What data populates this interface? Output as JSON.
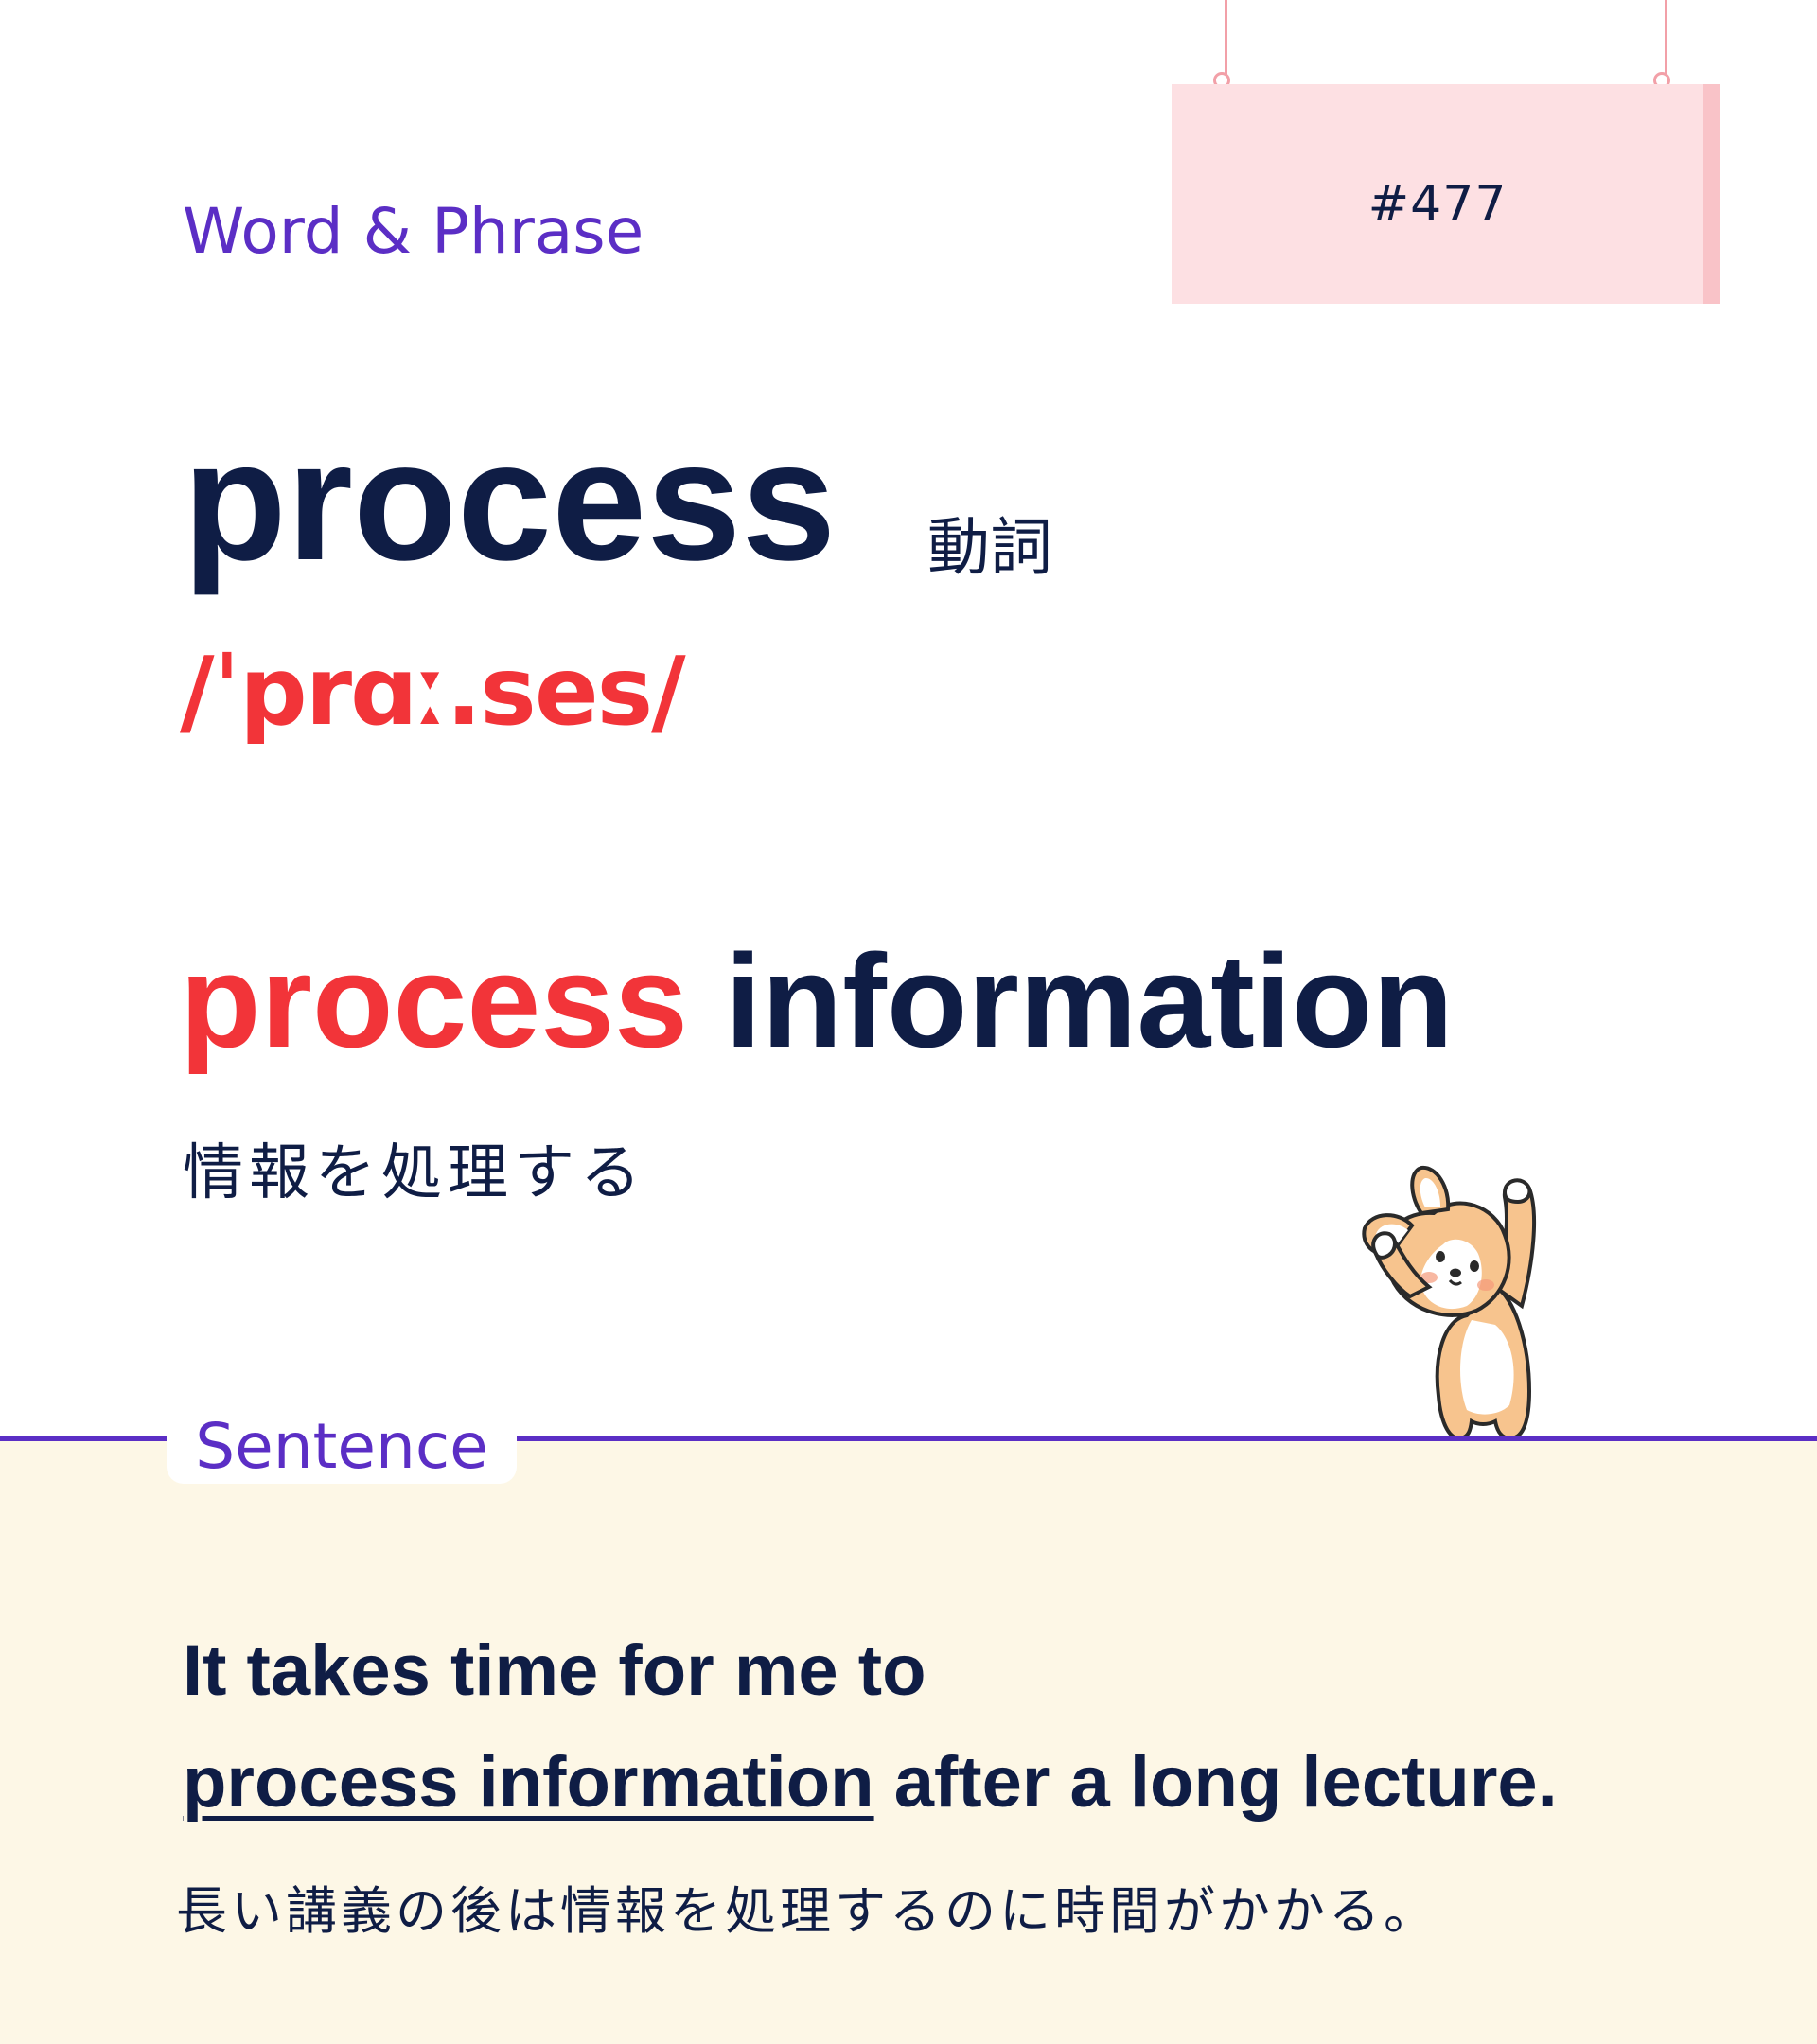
{
  "sign": {
    "number": "#477"
  },
  "header": {
    "category": "Word & Phrase"
  },
  "entry": {
    "word": "process",
    "part_of_speech": "動詞",
    "pronunciation": "/ˈprɑː.ses/"
  },
  "phrase": {
    "highlight": "process",
    "rest": "information",
    "translation": "情報を処理する"
  },
  "sentence": {
    "label": "Sentence",
    "line1": "It takes time for me to",
    "line2_underlined": "process information",
    "line2_rest": "after a long lecture.",
    "translation": "長い講義の後は情報を処理するのに時間がかかる。"
  },
  "colors": {
    "navy": "#0f1d45",
    "purple": "#5b2ec5",
    "red": "#f23439",
    "sign_pink": "#fde0e3",
    "cream": "#fdf7e6"
  },
  "illustration": {
    "icon": "corgi-mascot-icon"
  }
}
